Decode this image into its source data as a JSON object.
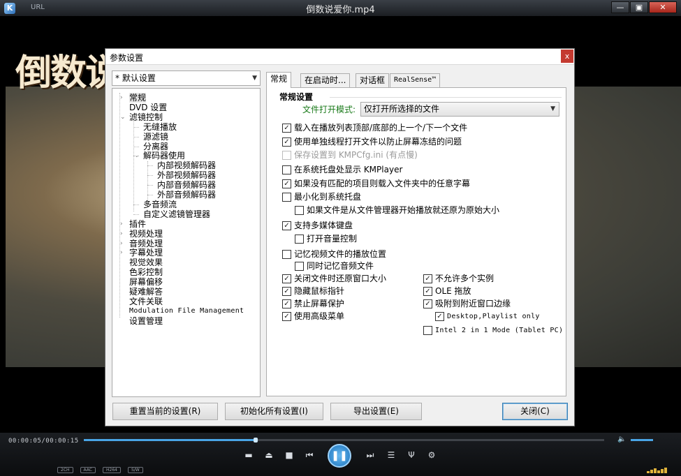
{
  "player": {
    "url_label": "URL",
    "window_title": "倒数说爱你.mp4",
    "window_controls": {
      "minimize": "—",
      "restore": "▣",
      "close": "✕"
    },
    "movie_title_art": "倒数说爱",
    "time_readout": "00:00:05/00:00:15",
    "progress": 0.33,
    "volume_icon": "🔈",
    "badges": [
      "2CH",
      "AAC",
      "H264",
      "S/W"
    ],
    "icons": [
      "subtitle-icon",
      "eject-icon",
      "stop-icon",
      "previous-icon",
      "pause-icon",
      "next-icon",
      "playlist-icon",
      "equalizer-icon",
      "settings-icon"
    ]
  },
  "dialog": {
    "title": "参数设置",
    "close_glyph": "x",
    "profile": "* 默认设置",
    "tree": [
      {
        "label": "常规",
        "level": 0,
        "twisty": ">",
        "selected": true
      },
      {
        "label": "DVD 设置",
        "level": 0,
        "twisty": "",
        "latin": false
      },
      {
        "label": "滤镜控制",
        "level": 0,
        "twisty": "v"
      },
      {
        "label": "无缝播放",
        "level": 1,
        "twisty": ""
      },
      {
        "label": "源滤镜",
        "level": 1,
        "twisty": ""
      },
      {
        "label": "分离器",
        "level": 1,
        "twisty": ""
      },
      {
        "label": "解码器使用",
        "level": 1,
        "twisty": "v"
      },
      {
        "label": "内部视频解码器",
        "level": 2,
        "twisty": ""
      },
      {
        "label": "外部视频解码器",
        "level": 2,
        "twisty": ""
      },
      {
        "label": "内部音频解码器",
        "level": 2,
        "twisty": ""
      },
      {
        "label": "外部音频解码器",
        "level": 2,
        "twisty": ""
      },
      {
        "label": "多音频流",
        "level": 1,
        "twisty": ""
      },
      {
        "label": "自定义滤镜管理器",
        "level": 1,
        "twisty": ""
      },
      {
        "label": "插件",
        "level": 0,
        "twisty": ">"
      },
      {
        "label": "视频处理",
        "level": 0,
        "twisty": ">"
      },
      {
        "label": "音频处理",
        "level": 0,
        "twisty": ">"
      },
      {
        "label": "字幕处理",
        "level": 0,
        "twisty": ">"
      },
      {
        "label": "视觉效果",
        "level": 0,
        "twisty": ""
      },
      {
        "label": "色彩控制",
        "level": 0,
        "twisty": ""
      },
      {
        "label": "屏幕偏移",
        "level": 0,
        "twisty": ""
      },
      {
        "label": "疑难解答",
        "level": 0,
        "twisty": ""
      },
      {
        "label": "文件关联",
        "level": 0,
        "twisty": ""
      },
      {
        "label": "Modulation File Management",
        "level": 0,
        "twisty": "",
        "latin": true
      },
      {
        "label": "设置管理",
        "level": 0,
        "twisty": ""
      }
    ],
    "tabs": [
      {
        "label": "常规",
        "active": true
      },
      {
        "label": "在启动时...",
        "active": false
      },
      {
        "label": "对话框",
        "active": false
      },
      {
        "label": "RealSense™",
        "active": false,
        "latin": true
      }
    ],
    "general": {
      "section_title": "常规设置",
      "open_mode_label": "文件打开模式:",
      "open_mode_value": "仅打开所选择的文件",
      "options": [
        {
          "label": "载入在播放列表顶部/底部的上一个/下一个文件",
          "checked": true
        },
        {
          "label": "使用单独线程打开文件以防止屏幕冻结的问题",
          "checked": true
        },
        {
          "label": "保存设置到 KMPCfg.ini (有点慢)",
          "checked": false,
          "disabled": true
        },
        {
          "label": "在系统托盘处显示 KMPlayer",
          "checked": false
        },
        {
          "label": "如果没有匹配的项目则载入文件夹中的任意字幕",
          "checked": true
        },
        {
          "label": "最小化到系统托盘",
          "checked": false
        },
        {
          "label": "如果文件是从文件管理器开始播放就还原为原始大小",
          "checked": false
        },
        {
          "label": "支持多媒体键盘",
          "checked": true
        },
        {
          "label": "打开音量控制",
          "checked": false
        },
        {
          "label": "记忆视频文件的播放位置",
          "checked": false
        },
        {
          "label": "同时记忆音频文件",
          "checked": false
        },
        {
          "label": "关闭文件时还原窗口大小",
          "checked": true
        },
        {
          "label": "隐藏鼠标指针",
          "checked": true
        },
        {
          "label": "禁止屏幕保护",
          "checked": true
        },
        {
          "label": "使用高级菜单",
          "checked": true
        },
        {
          "label": "不允许多个实例",
          "checked": true
        },
        {
          "label": "OLE 拖放",
          "checked": true
        },
        {
          "label": "吸附到附近窗口边缘",
          "checked": true
        },
        {
          "label": "Desktop,Playlist only",
          "checked": true,
          "latin": true
        },
        {
          "label": "Intel 2 in 1 Mode (Tablet PC)",
          "checked": false,
          "latin": true
        }
      ]
    },
    "buttons": {
      "reset_current": "重置当前的设置(R)",
      "init_all": "初始化所有设置(I)",
      "export": "导出设置(E)",
      "close": "关闭(C)"
    }
  }
}
